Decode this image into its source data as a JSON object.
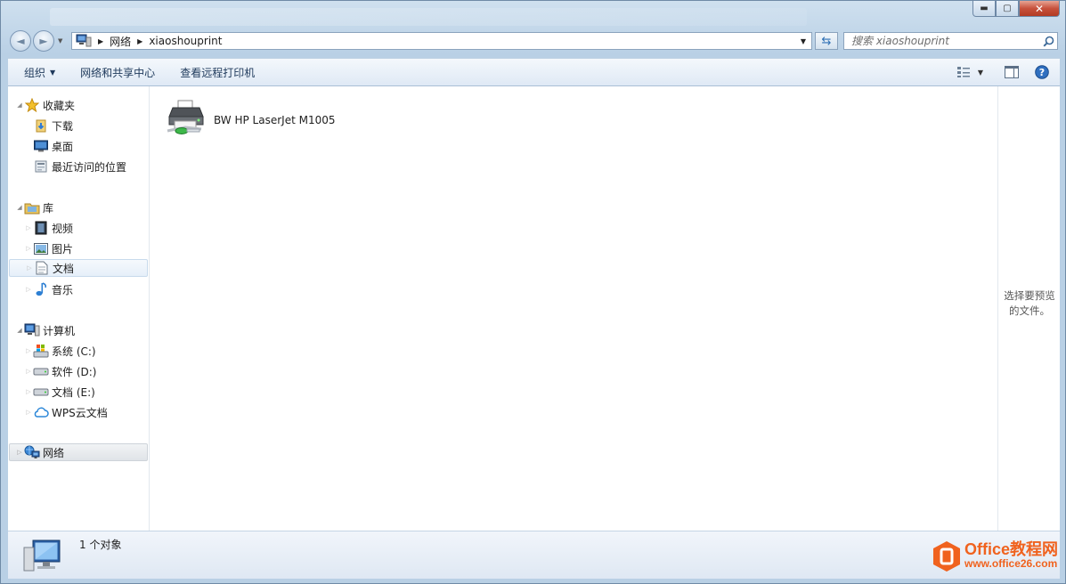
{
  "window": {
    "controls": {
      "minimize": "▬",
      "maximize": "▢",
      "close": "✕"
    }
  },
  "navigation": {
    "back": "◄",
    "forward": "►"
  },
  "address": {
    "crumbs": [
      "网络",
      "xiaoshouprint"
    ],
    "separator": "▶"
  },
  "search": {
    "placeholder": "搜索 xiaoshouprint"
  },
  "toolbar": {
    "organize": "组织",
    "network_center": "网络和共享中心",
    "remote_printers": "查看远程打印机"
  },
  "sidebar": {
    "favorites": {
      "label": "收藏夹",
      "items": [
        "下载",
        "桌面",
        "最近访问的位置"
      ]
    },
    "libraries": {
      "label": "库",
      "items": [
        "视频",
        "图片",
        "文档",
        "音乐"
      ]
    },
    "computer": {
      "label": "计算机",
      "items": [
        "系统 (C:)",
        "软件 (D:)",
        "文档 (E:)",
        "WPS云文档"
      ]
    },
    "network": {
      "label": "网络"
    }
  },
  "main": {
    "printer_name": "BW HP LaserJet M1005"
  },
  "preview": {
    "text": "选择要预览的文件。"
  },
  "status": {
    "count": "1 个对象"
  },
  "watermark": {
    "line1": "Office教程网",
    "line2": "www.office26.com"
  },
  "colors": {
    "accent": "#1e395b",
    "watermark": "#f0621e"
  }
}
